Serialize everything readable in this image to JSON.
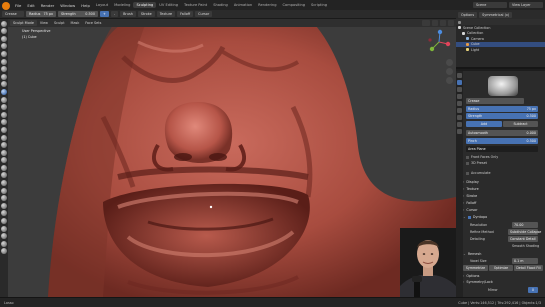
{
  "menu": {
    "items": [
      "File",
      "Edit",
      "Render",
      "Window",
      "Help"
    ],
    "workspaces": [
      "Layout",
      "Modeling",
      "Sculpting",
      "UV Editing",
      "Texture Paint",
      "Shading",
      "Animation",
      "Rendering",
      "Compositing",
      "Scripting"
    ],
    "active_workspace": "Sculpting",
    "scene": "Scene",
    "view_layer": "View Layer"
  },
  "tool_header": {
    "brush": "Crease",
    "radius_label": "Radius",
    "radius_value": "75 px",
    "strength_label": "Strength",
    "strength_value": "0.500",
    "add": "+",
    "sub": "-",
    "brush_menu": "Brush",
    "stroke_menu": "Stroke",
    "texture_menu": "Texture",
    "falloff_menu": "Falloff",
    "cursor_menu": "Cursor"
  },
  "viewport_header": {
    "mode": "Sculpt Mode",
    "menus": [
      "View",
      "Sculpt",
      "Mask",
      "Face Sets"
    ]
  },
  "overlay_text": {
    "view": "User Perspective",
    "object": "(1) Cube"
  },
  "right_header": {
    "options": "Options",
    "transform": "Symmetrical (x)"
  },
  "outliner": {
    "root": "Scene Collection",
    "items": [
      {
        "label": "Collection",
        "selected": false
      },
      {
        "label": "Camera",
        "selected": false
      },
      {
        "label": "Cube",
        "selected": true
      },
      {
        "label": "Light",
        "selected": false
      }
    ]
  },
  "properties": {
    "brush_name": "Crease",
    "radius_label": "Radius",
    "radius_value": "75 px",
    "strength_label": "Strength",
    "strength_value": "0.500",
    "direction_add": "Add",
    "direction_sub": "Subtract",
    "autosmooth_label": "Autosmooth",
    "autosmooth_value": "0.000",
    "pinch_label": "Pinch",
    "pinch_value": "0.500",
    "area_plane": "Area Plane",
    "front_faces": "Front Faces Only",
    "plane_offset": "3D Preset",
    "accumulate": "Accumulate",
    "sections": [
      "Display",
      "Texture",
      "Stroke",
      "Falloff",
      "Cursor",
      "Dyntopo"
    ],
    "resolution_label": "Resolution",
    "resolution_value": "70.00",
    "refine_label": "Refine Method",
    "refine_value": "Subdivide Collapse",
    "detailing_label": "Detailing",
    "detailing_value": "Constant Detail",
    "smooth_shading": "Smooth Shading",
    "remesh": "Remesh",
    "voxel_label": "Voxel Size",
    "voxel_value": "0.1 m",
    "remesh_buttons": [
      "Symmetrize",
      "Optimize",
      "Detail Flood Fill"
    ],
    "options": "Options",
    "symmetry": "Symmetry/Lock",
    "mirror_label": "Mirror",
    "mirror_value": "X"
  },
  "status": {
    "left": "Lasso",
    "right": "Cube | Verts:146,512 | Tris:292,416 | Objects:1/3"
  }
}
